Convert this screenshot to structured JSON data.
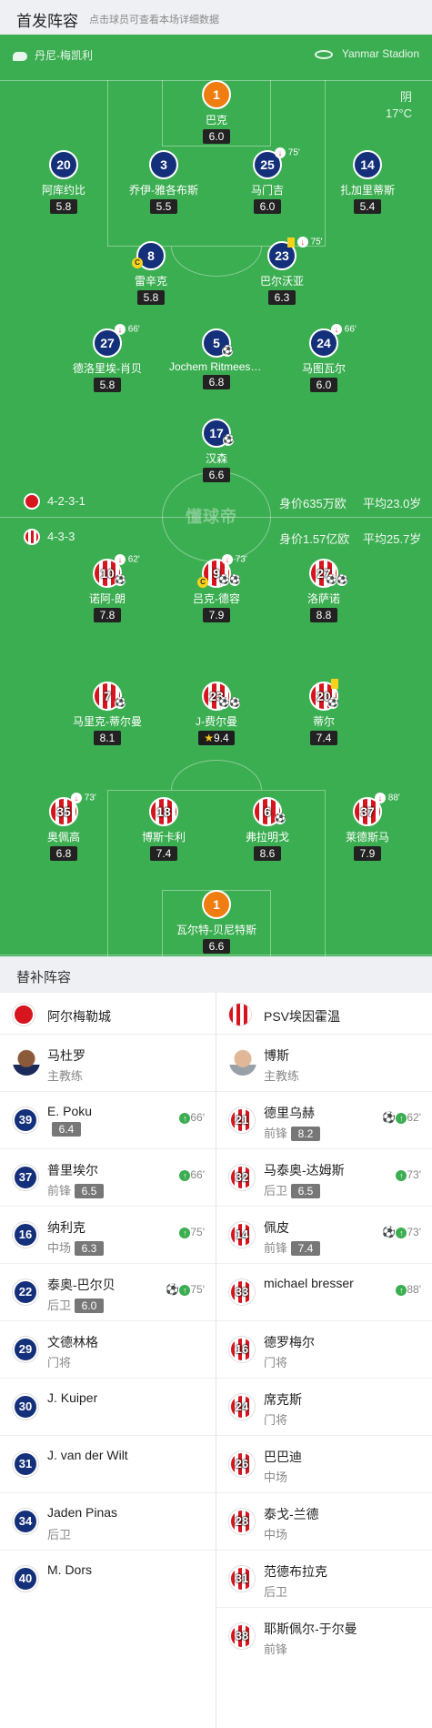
{
  "header": {
    "title": "首发阵容",
    "subtitle": "点击球员可查看本场详细数据"
  },
  "match": {
    "referee": "丹尼-梅凯利",
    "venue": "Yanmar Stadion",
    "weather": "阴",
    "temperature": "17°C"
  },
  "home": {
    "formation": "4-2-3-1",
    "value": "身价635万欧",
    "avg_age": "平均23.0岁",
    "color": "#14307a",
    "players": [
      {
        "num": "1",
        "name": "巴克",
        "rating": "6.0"
      },
      {
        "num": "20",
        "name": "阿库约比",
        "rating": "5.8"
      },
      {
        "num": "3",
        "name": "乔伊-雅各布斯",
        "rating": "5.5"
      },
      {
        "num": "25",
        "name": "马门吉",
        "rating": "6.0",
        "event": "75'"
      },
      {
        "num": "14",
        "name": "扎加里蒂斯",
        "rating": "5.4"
      },
      {
        "num": "8",
        "name": "雷辛克",
        "rating": "5.8"
      },
      {
        "num": "23",
        "name": "巴尔沃亚",
        "rating": "6.3",
        "event": "75'"
      },
      {
        "num": "27",
        "name": "德洛里埃-肖贝",
        "rating": "5.8",
        "event": "66'"
      },
      {
        "num": "5",
        "name": "Jochem Ritmeester van de Kamp",
        "rating": "6.8"
      },
      {
        "num": "24",
        "name": "马图瓦尔",
        "rating": "6.0",
        "event": "66'"
      },
      {
        "num": "17",
        "name": "汉森",
        "rating": "6.6"
      }
    ]
  },
  "away": {
    "formation": "4-3-3",
    "value": "身价1.57亿欧",
    "avg_age": "平均25.7岁",
    "color": "#d6151f",
    "players": [
      {
        "num": "10",
        "name": "诺阿-朗",
        "rating": "7.8",
        "event": "62'"
      },
      {
        "num": "9",
        "name": "吕克-德容",
        "rating": "7.9",
        "event": "73'"
      },
      {
        "num": "27",
        "name": "洛萨诺",
        "rating": "8.8"
      },
      {
        "num": "7",
        "name": "马里克-蒂尔曼",
        "rating": "8.1"
      },
      {
        "num": "23",
        "name": "J-费尔曼",
        "rating": "9.4"
      },
      {
        "num": "20",
        "name": "蒂尔",
        "rating": "7.4"
      },
      {
        "num": "35",
        "name": "奥佩高",
        "rating": "6.8",
        "event": "73'"
      },
      {
        "num": "18",
        "name": "博斯卡利",
        "rating": "7.4"
      },
      {
        "num": "6",
        "name": "弗拉明戈",
        "rating": "8.6"
      },
      {
        "num": "37",
        "name": "莱德斯马",
        "rating": "7.9",
        "event": "88'"
      },
      {
        "num": "1",
        "name": "瓦尔特-贝尼特斯",
        "rating": "6.6"
      }
    ]
  },
  "watermark": "懂球帝",
  "subs_section": {
    "title": "替补阵容",
    "home_team": "阿尔梅勒城",
    "away_team": "PSV埃因霍温",
    "home_coach": {
      "name": "马杜罗",
      "role": "主教练"
    },
    "away_coach": {
      "name": "博斯",
      "role": "主教练"
    },
    "home_subs": [
      {
        "num": "39",
        "name": "E. Poku",
        "pos": "",
        "rating": "6.4",
        "event": "66'"
      },
      {
        "num": "37",
        "name": "普里埃尔",
        "pos": "前锋",
        "rating": "6.5",
        "event": "66'"
      },
      {
        "num": "16",
        "name": "纳利克",
        "pos": "中场",
        "rating": "6.3",
        "event": "75'"
      },
      {
        "num": "22",
        "name": "泰奥-巴尔贝",
        "pos": "后卫",
        "rating": "6.0",
        "event": "75'"
      },
      {
        "num": "29",
        "name": "文德林格",
        "pos": "门将",
        "rating": "",
        "event": ""
      },
      {
        "num": "30",
        "name": "J. Kuiper",
        "pos": "",
        "rating": "",
        "event": ""
      },
      {
        "num": "31",
        "name": "J. van der Wilt",
        "pos": "",
        "rating": "",
        "event": ""
      },
      {
        "num": "34",
        "name": "Jaden Pinas",
        "pos": "后卫",
        "rating": "",
        "event": ""
      },
      {
        "num": "40",
        "name": "M. Dors",
        "pos": "",
        "rating": "",
        "event": ""
      }
    ],
    "away_subs": [
      {
        "num": "21",
        "name": "德里乌赫",
        "pos": "前锋",
        "rating": "8.2",
        "event": "62'"
      },
      {
        "num": "32",
        "name": "马泰奥-达姆斯",
        "pos": "后卫",
        "rating": "6.5",
        "event": "73'"
      },
      {
        "num": "14",
        "name": "佩皮",
        "pos": "前锋",
        "rating": "7.4",
        "event": "73'"
      },
      {
        "num": "33",
        "name": "michael bresser",
        "pos": "",
        "rating": "",
        "event": "88'"
      },
      {
        "num": "16",
        "name": "德罗梅尔",
        "pos": "门将",
        "rating": "",
        "event": ""
      },
      {
        "num": "24",
        "name": "席克斯",
        "pos": "门将",
        "rating": "",
        "event": ""
      },
      {
        "num": "26",
        "name": "巴巴迪",
        "pos": "中场",
        "rating": "",
        "event": ""
      },
      {
        "num": "28",
        "name": "泰戈-兰德",
        "pos": "中场",
        "rating": "",
        "event": ""
      },
      {
        "num": "31",
        "name": "范德布拉克",
        "pos": "后卫",
        "rating": "",
        "event": ""
      },
      {
        "num": "38",
        "name": "耶斯佩尔-于尔曼",
        "pos": "前锋",
        "rating": "",
        "event": ""
      }
    ]
  }
}
